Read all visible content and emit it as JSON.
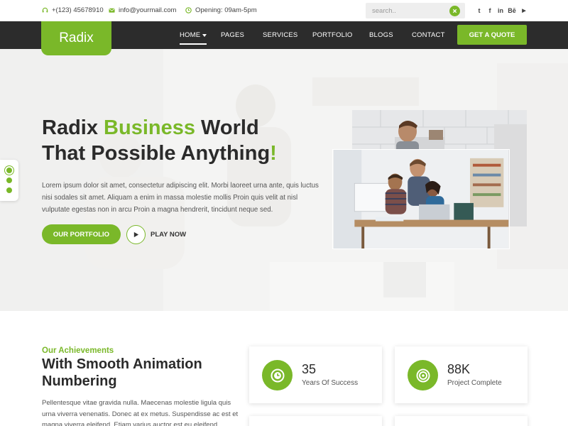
{
  "topbar": {
    "phone": "+(123) 45678910",
    "email": "info@yourmail.com",
    "hours": "Opening: 09am-5pm",
    "search_placeholder": "search..",
    "social": [
      "twitter-icon",
      "facebook-icon",
      "linkedin-icon",
      "behance-icon",
      "youtube-icon"
    ],
    "social_labels": {
      "twitter": "t",
      "facebook": "f",
      "linkedin": "in",
      "behance": "Bē",
      "youtube": "▶"
    }
  },
  "nav": {
    "logo": "Radix",
    "items": [
      "HOME",
      "PAGES",
      "SERVICES",
      "PORTFOLIO",
      "BLOGS",
      "CONTACT"
    ],
    "cta": "GET A QUOTE"
  },
  "hero": {
    "title_part1": "Radix ",
    "title_highlight": "Business",
    "title_part2": " World",
    "title_line2": "That Possible Anything",
    "title_excl": "!",
    "description": "Lorem ipsum dolor sit amet, consectetur adipiscing elit. Morbi laoreet urna ante, quis luctus nisi sodales sit amet. Aliquam a enim in massa molestie mollis Proin quis velit at nisl vulputate egestas non in arcu Proin a magna hendrerit, tincidunt neque sed.",
    "primary_button": "OUR PORTFOLIO",
    "play_label": "PLAY NOW",
    "slider_dots": 3,
    "active_dot": 0
  },
  "achievements": {
    "kicker": "Our Achievements",
    "title": "With Smooth Animation Numbering",
    "description": "Pellentesque vitae gravida nulla. Maecenas molestie ligula quis urna viverra venenatis. Donec at ex metus. Suspendisse ac est et magna viverra eleifend. Etiam varius auctor est eu eleifend.",
    "stats": [
      {
        "icon": "clock-icon",
        "value": "35",
        "label": "Years Of Success"
      },
      {
        "icon": "target-icon",
        "value": "88K",
        "label": "Project Complete"
      }
    ]
  },
  "colors": {
    "accent": "#7ab829",
    "nav_bg": "#2c2c2c",
    "heading": "#2b2b2b"
  }
}
